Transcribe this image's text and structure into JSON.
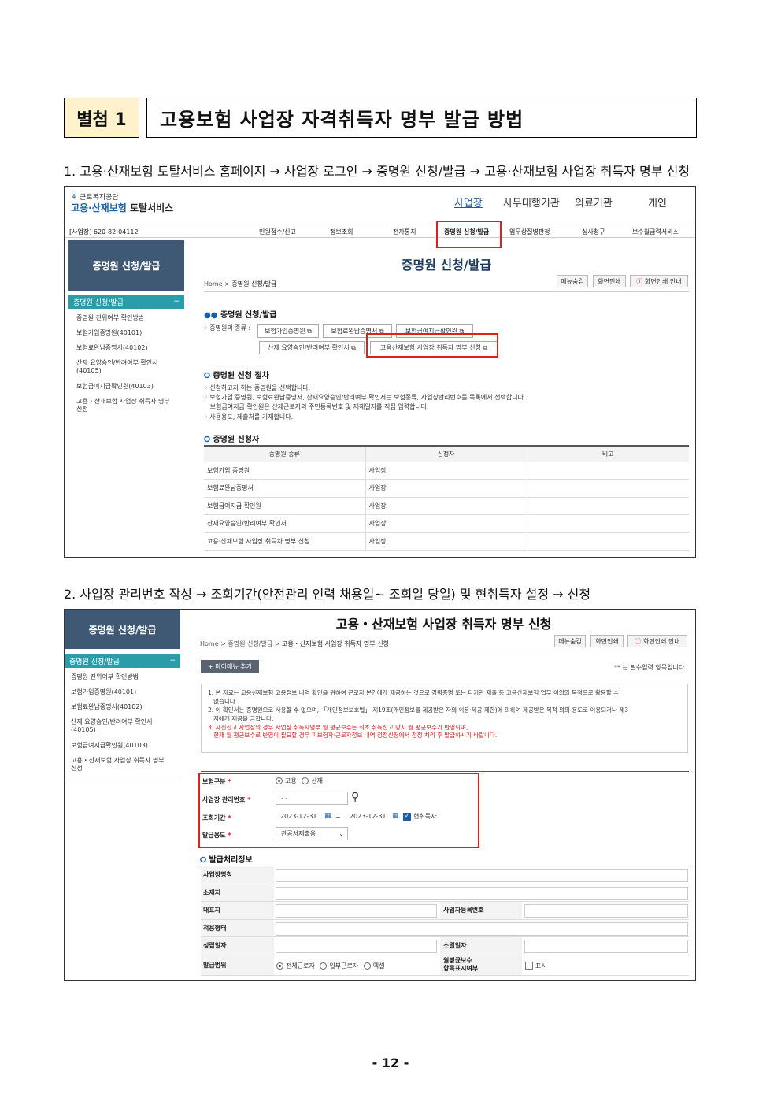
{
  "header": {
    "tag": "별첨 1",
    "title": "고용보험 사업장 자격취득자 명부 발급 방법"
  },
  "steps": {
    "step1": "1.  고용·산재보험 토탈서비스 홈페이지 → 사업장 로그인 → 증명원 신청/발급 → 고용·산재보험 사업장 취득자 명부 신청",
    "step2": "2.  사업장  관리번호  작성  →  조회기간(안전관리  인력  채용일~  조회일  당일)  및  현취득자  설정  →  신청"
  },
  "shot1": {
    "logo_top": "근로복지공단",
    "logo_main": "고용·산재보험",
    "logo_sub": "토탈서비스",
    "topnav": [
      "사업장",
      "사무대행기관",
      "의료기관",
      "개인"
    ],
    "biz_no": "[사업장] 620-82-04112",
    "gnb": [
      "민원접수/신고",
      "정보조회",
      "전자통지",
      "증명원 신청/발급",
      "업무상질병판정",
      "심사청구",
      "보수월급력서비스"
    ],
    "side_head": "증명원 신청/발급",
    "side_active": "증명원 신청/발급",
    "side_minus": "−",
    "side_items": [
      "증명원 진위여부 확인방법",
      "보험가입증명원(40101)",
      "보험료완납증명서(40102)",
      "산재 요양승인/반려여부 확인서\n(40105)",
      "보험급여지급확인원(40103)",
      "고용・산재보험 사업장 취득자 명부\n신청"
    ],
    "page_title": "증명원 신청/발급",
    "breadcrumb_home": "Home",
    "breadcrumb_current": "증명원 신청/발급",
    "buttons": [
      "메뉴숨김",
      "화면인쇄",
      "화면인쇄 안내"
    ],
    "sec1_title": "증명원 신청/발급",
    "kinds_label": "◦ 증명원의 종류 :",
    "cert_buttons": [
      "보험가입증명원",
      "보험료완납증명서",
      "보험급여지급확인원",
      "산재 요양승인/반려여부 확인서",
      "고용산재보험 사업장 취득자 명부 신청"
    ],
    "sec2_title": "증명원 신청 절차",
    "procedure": [
      "◦ 신청하고자 하는 증명원을 선택합니다.",
      "◦ 보험가입 증명원, 보험료완납증명서, 산재요양승인/반려여부 확인서는 보험종류, 사업장관리번호를 목록에서 선택합니다.",
      "   보험급여지급 확인원은 산재근로자의 주민등록번호 및 재해일자를 직접 입력합니다.",
      "◦ 사용용도, 제출처를 기재합니다."
    ],
    "sec3_title": "증명원 신청자",
    "table_headers": [
      "증명원 종류",
      "신청자",
      "비고"
    ],
    "table_rows": [
      [
        "보험가입 증명원",
        "사업장",
        ""
      ],
      [
        "보험료완납증명서",
        "사업장",
        ""
      ],
      [
        "보험급여지급 확인원",
        "사업장",
        ""
      ],
      [
        "산재요양승인/반려여부 확인서",
        "사업장",
        ""
      ],
      [
        "고용·산재보험 사업장 취득자 명부 신청",
        "사업장",
        ""
      ]
    ]
  },
  "shot2": {
    "side_head": "증명원 신청/발급",
    "side_active": "증명원 신청/발급",
    "side_minus": "−",
    "side_items": [
      "증명원 진위여부 확인방법",
      "보험가입증명원(40101)",
      "보험료완납증명서(40102)",
      "산재 요양승인/반려여부 확인서\n(40105)",
      "보험급여지급확인원(40103)",
      "고용・산재보험 사업장 취득자 명부\n신청"
    ],
    "page_title": "고용・산재보험 사업장 취득자 명부 신청",
    "breadcrumb_home": "Home",
    "breadcrumb_mid": "증명원 신청/발급",
    "breadcrumb_current": "고용・산재보험 사업장 취득자 명부 신청",
    "buttons": [
      "메뉴숨김",
      "화면인쇄",
      "화면인쇄 안내"
    ],
    "mymenu": "+ 마이메뉴 추가",
    "required_note": "* 는 필수입력 항목입니다.",
    "notice": [
      "1. 본 자료는 고용산재보험 고용정보 내역 확인을 위하여 근로자 본인에게 제공하는 것으로 경력증명 또는 타기관 제출 등 고용산재보험 업무 이외의 목적으로 활용할 수",
      "   없습니다.",
      "2. 이 확인서는 증명원으로 사용할 수 없으며, 「개인정보보호법」 제19조(개인정보를 제공받은 자의 이용·제공 제한)에 의하여 제공받은 목적 외의 용도로 이용되거나 제3",
      "   자에게 제공을 금합니다.",
      "3. 자진신고 사업장의 경우 사업장 취득자명부 월 평균보수는 최초 취득신고 당시 월 평균보수가 반영되며,",
      "   현재 월 평균보수로 반영이 필요할 경우 피보험자·근로자정보 내역 정정신청에서 정정 처리 후 발급하시기 바랍니다."
    ],
    "form": {
      "insurance_label": "보험구분",
      "insurance_opt1": "고용",
      "insurance_opt2": "산재",
      "biz_label": "사업장 관리번호",
      "biz_value": "- -",
      "period_label": "조회기간",
      "date_from": "2023-12-31",
      "date_tilde": "~",
      "date_to": "2023-12-31",
      "current_label": "현취득자",
      "purpose_label": "발급용도",
      "purpose_value": "관공서제출용",
      "req_mark": "*"
    },
    "issue_title": "발급처리정보",
    "issue_rows": {
      "name": "사업장명칭",
      "addr": "소재지",
      "rep": "대표자",
      "regno": "사업자등록번호",
      "type": "적용형태",
      "est": "성립일자",
      "close": "소멸일자",
      "range": "발급범위",
      "range_opt1": "전체근로자",
      "range_opt2": "일부근로자",
      "range_opt3": "엑셀",
      "avgpay": "월평균보수\n항목표시여부",
      "show": "표시"
    }
  },
  "page_number": "- 12 -",
  "colors": {
    "accent": "#1a5fa8",
    "highlight_red": "#e0201f",
    "side_head": "#3f5873",
    "side_active": "#2a9da8",
    "tag_bg": "#fff2cc"
  }
}
